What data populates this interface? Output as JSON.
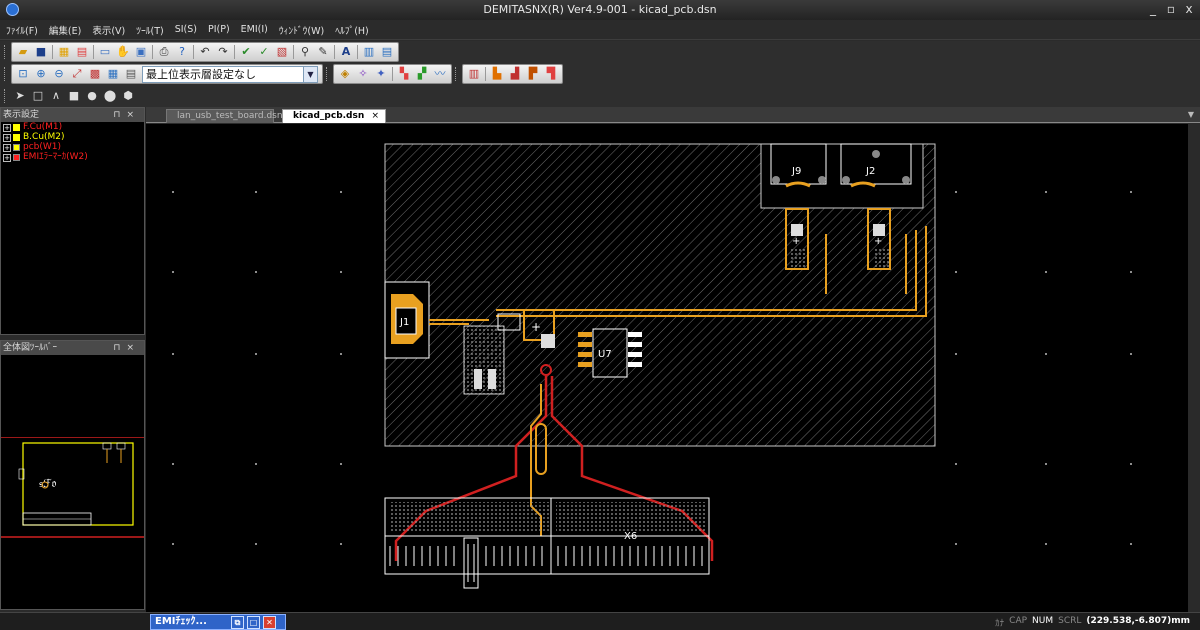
{
  "window": {
    "title": "DEMITASNX(R) Ver4.9-001 - kicad_pcb.dsn",
    "controls": [
      "_",
      "▫",
      "x"
    ]
  },
  "menu": [
    "ﾌｧｲﾙ(F)",
    "編集(E)",
    "表示(V)",
    "ﾂｰﾙ(T)",
    "SI(S)",
    "PI(P)",
    "EMI(I)",
    "ｳｨﾝﾄﾞｳ(W)",
    "ﾍﾙﾌﾟ(H)"
  ],
  "toolbar": {
    "layer_combo_value": "最上位表示層設定なし"
  },
  "panels": {
    "display_settings": {
      "title": "表示設定",
      "layers": [
        {
          "label": "F.Cu(M1)",
          "color": "#ff2020",
          "swatch": "#ffff00"
        },
        {
          "label": "B.Cu(M2)",
          "color": "#ffff00",
          "swatch": "#ffff00"
        },
        {
          "label": "pcb(W1)",
          "color": "#ff2020",
          "swatch": "#ffff00"
        },
        {
          "label": "EMIｴﾗｰﾏｰｶ(W2)",
          "color": "#ff2020",
          "swatch": "#ff2020"
        }
      ]
    },
    "overview": {
      "title": "全体図ﾂｰﾙﾊﾞｰ"
    }
  },
  "tabs": [
    {
      "label": "lan_usb_test_board.dsn",
      "active": false
    },
    {
      "label": "kicad_pcb.dsn",
      "active": true
    }
  ],
  "board": {
    "labels": {
      "j1": "J1",
      "j9": "J9",
      "j2": "J2",
      "u7": "U7",
      "x6": "X6"
    },
    "colors": {
      "track_orange": "#e8a020",
      "track_red": "#d02020",
      "outline": "#ffffff",
      "hatch": "#808080"
    }
  },
  "taskbar": {
    "minimized_window": "EMIﾁｪｯｸ..."
  },
  "status": {
    "items": [
      "ｶﾅ",
      "CAP",
      "NUM",
      "SCRL"
    ],
    "active": [
      "NUM"
    ],
    "coordinate": "(229.538,-6.807)mm"
  }
}
